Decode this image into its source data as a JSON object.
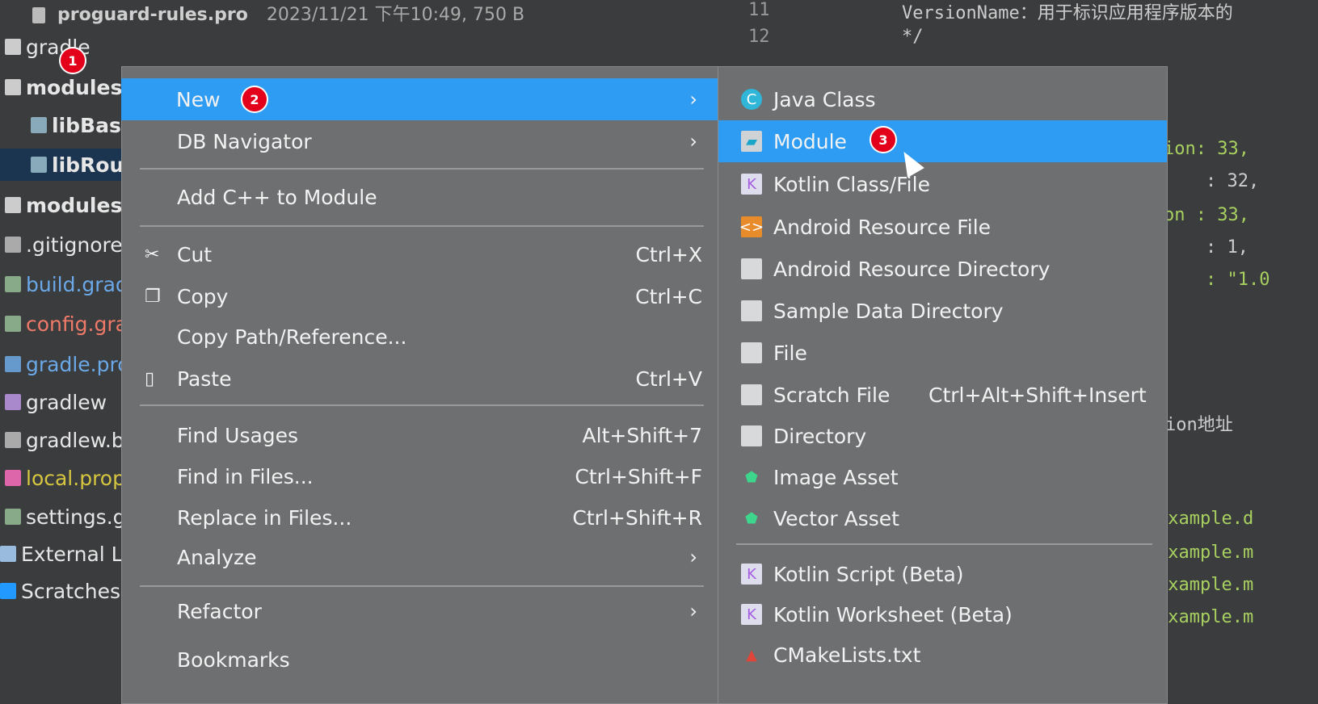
{
  "header": {
    "file": "proguard-rules.pro",
    "meta": "2023/11/21 下午10:49, 750 B"
  },
  "tree": [
    {
      "label": "gradle",
      "color": "#e6e6e6"
    },
    {
      "label": "modules",
      "color": "#e6e6e6"
    },
    {
      "label": "libBase",
      "color": "#e6e6e6"
    },
    {
      "label": "libRouter",
      "color": "#e6e6e6"
    },
    {
      "label": "modules",
      "color": "#e6e6e6"
    },
    {
      "label": ".gitignore",
      "color": "#e6e6e6"
    },
    {
      "label": "build.gradle",
      "color": "#6aa8e8"
    },
    {
      "label": "config.gradle",
      "color": "#f07a6a"
    },
    {
      "label": "gradle.properties",
      "color": "#6aa8e8"
    },
    {
      "label": "gradlew",
      "color": "#e6e6e6"
    },
    {
      "label": "gradlew.bat",
      "color": "#e6e6e6"
    },
    {
      "label": "local.properties",
      "color": "#d6c640"
    },
    {
      "label": "settings.gradle",
      "color": "#e6e6e6"
    },
    {
      "label": "External Libraries",
      "color": "#e6e6e6"
    },
    {
      "label": "Scratches and Consoles",
      "color": "#e6e6e6"
    }
  ],
  "code": {
    "line_numbers": [
      "11",
      "12"
    ],
    "line11": "VersionName：用于标识应用程序版本的",
    "line12": "*/",
    "fragments": [
      "ion: 33,",
      ": 32,",
      "on : 33,",
      ": 1,",
      ": \"1.0",
      "ion地址",
      "example.d",
      "example.m",
      "example.m",
      "example.m"
    ]
  },
  "context_menu": {
    "items": [
      {
        "label": "New",
        "submenu": true
      },
      {
        "label": "DB Navigator",
        "submenu": true
      },
      {
        "label": "Add C++ to Module"
      },
      {
        "label": "Cut",
        "shortcut": "Ctrl+X",
        "icon": "scissors-icon"
      },
      {
        "label": "Copy",
        "shortcut": "Ctrl+C",
        "icon": "copy-icon"
      },
      {
        "label": "Copy Path/Reference..."
      },
      {
        "label": "Paste",
        "shortcut": "Ctrl+V",
        "icon": "clipboard-icon"
      },
      {
        "label": "Find Usages",
        "shortcut": "Alt+Shift+7"
      },
      {
        "label": "Find in Files...",
        "shortcut": "Ctrl+Shift+F"
      },
      {
        "label": "Replace in Files...",
        "shortcut": "Ctrl+Shift+R"
      },
      {
        "label": "Analyze",
        "submenu": true
      },
      {
        "label": "Refactor",
        "submenu": true
      },
      {
        "label": "Bookmarks"
      }
    ]
  },
  "new_submenu": {
    "items": [
      {
        "label": "Java Class"
      },
      {
        "label": "Module"
      },
      {
        "label": "Kotlin Class/File"
      },
      {
        "label": "Android Resource File"
      },
      {
        "label": "Android Resource Directory"
      },
      {
        "label": "Sample Data Directory"
      },
      {
        "label": "File"
      },
      {
        "label": "Scratch File",
        "shortcut": "Ctrl+Alt+Shift+Insert"
      },
      {
        "label": "Directory"
      },
      {
        "label": "Image Asset"
      },
      {
        "label": "Vector Asset"
      },
      {
        "label": "Kotlin Script (Beta)"
      },
      {
        "label": "Kotlin Worksheet (Beta)"
      },
      {
        "label": "CMakeLists.txt"
      }
    ]
  },
  "steps": [
    "1",
    "2",
    "3"
  ],
  "colors": {
    "highlight": "#2e9cf2",
    "menu": "#6e6f70",
    "badge": "#e3001b"
  }
}
